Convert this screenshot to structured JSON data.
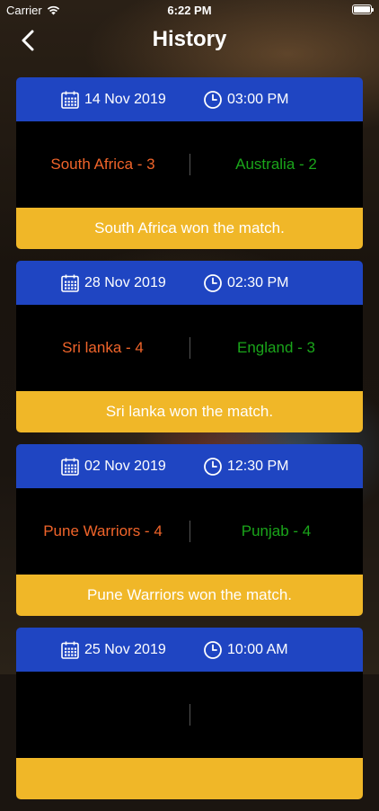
{
  "status_bar": {
    "carrier": "Carrier",
    "time": "6:22 PM"
  },
  "nav": {
    "title": "History",
    "back_icon": "chevron-left-icon"
  },
  "colors": {
    "header_blue": "#1f45c2",
    "footer_yellow": "#f0b728",
    "team_a_orange": "#f0642a",
    "team_b_green": "#1aa51a"
  },
  "matches": [
    {
      "date": "14 Nov 2019",
      "time": "03:00 PM",
      "team_a": "South Africa - 3",
      "team_b": "Australia - 2",
      "result": "South Africa won the match."
    },
    {
      "date": "28 Nov 2019",
      "time": "02:30 PM",
      "team_a": "Sri lanka  - 4",
      "team_b": "England - 3",
      "result": "Sri lanka  won the match."
    },
    {
      "date": "02 Nov 2019",
      "time": "12:30 PM",
      "team_a": "Pune Warriors  - 4",
      "team_b": "Punjab  - 4",
      "result": "Pune Warriors  won the match."
    },
    {
      "date": "25 Nov 2019",
      "time": "10:00 AM",
      "team_a": "",
      "team_b": "",
      "result": ""
    }
  ]
}
